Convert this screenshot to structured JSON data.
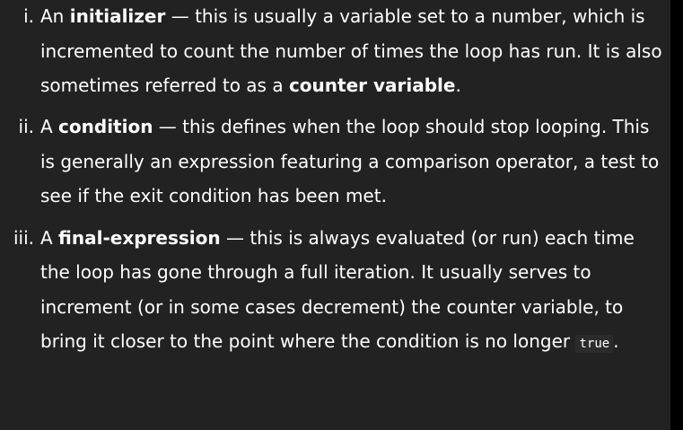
{
  "items": [
    {
      "marker": "i.",
      "lead": "An ",
      "term": "initializer",
      "text1": " — this is usually a variable set to a number, which is incremented to count the number of times the loop has run. It is also sometimes referred to as a ",
      "term2": "counter variable",
      "text2": "."
    },
    {
      "marker": "ii.",
      "lead": "A ",
      "term": "condition",
      "text1": " — this defines when the loop should stop looping. This is generally an expression featuring a comparison operator, a test to see if the exit condition has been met."
    },
    {
      "marker": "iii.",
      "lead": "A ",
      "term": "final-expression",
      "text1": " — this is always evaluated (or run) each time the loop has gone through a full iteration. It usually serves to increment (or in some cases decrement) the counter variable, to bring it closer to the point where the condition is no longer ",
      "code": "true",
      "text2": "."
    }
  ]
}
